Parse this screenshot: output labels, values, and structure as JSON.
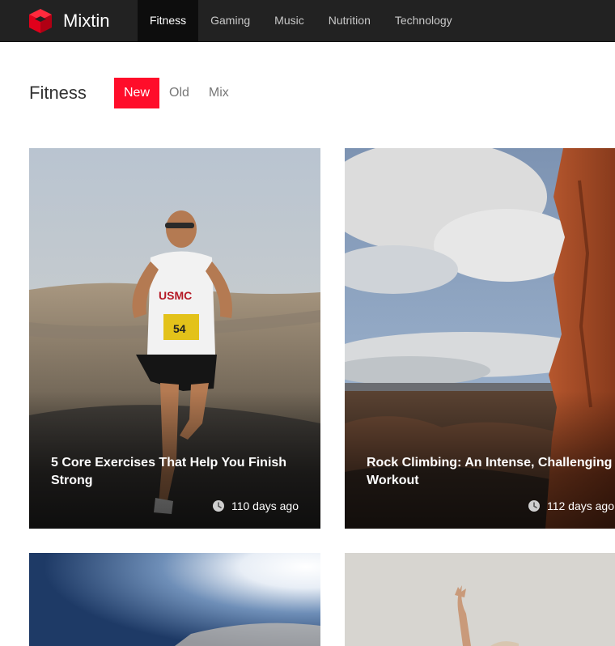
{
  "brand": {
    "name": "Mixtin",
    "logo_icon": "cube-logo-icon",
    "accent": "#ff0d2a"
  },
  "nav": {
    "items": [
      {
        "label": "Fitness",
        "active": true
      },
      {
        "label": "Gaming",
        "active": false
      },
      {
        "label": "Music",
        "active": false
      },
      {
        "label": "Nutrition",
        "active": false
      },
      {
        "label": "Technology",
        "active": false
      }
    ]
  },
  "section": {
    "title": "Fitness",
    "filters": [
      {
        "label": "New",
        "active": true
      },
      {
        "label": "Old",
        "active": false
      },
      {
        "label": "Mix",
        "active": false
      }
    ]
  },
  "cards": [
    {
      "title": "5 Core Exercises That Help You Finish Strong",
      "time": "110 days ago",
      "image": "marathon-runner-photo",
      "time_icon": "clock-icon"
    },
    {
      "title": "Rock Climbing: An Intense, Challenging Workout",
      "time": "112 days ago",
      "image": "canyon-cliff-photo",
      "time_icon": "clock-icon"
    },
    {
      "title": "",
      "time": "",
      "image": "sunny-sky-photo"
    },
    {
      "title": "",
      "time": "",
      "image": "raised-hand-photo"
    }
  ]
}
